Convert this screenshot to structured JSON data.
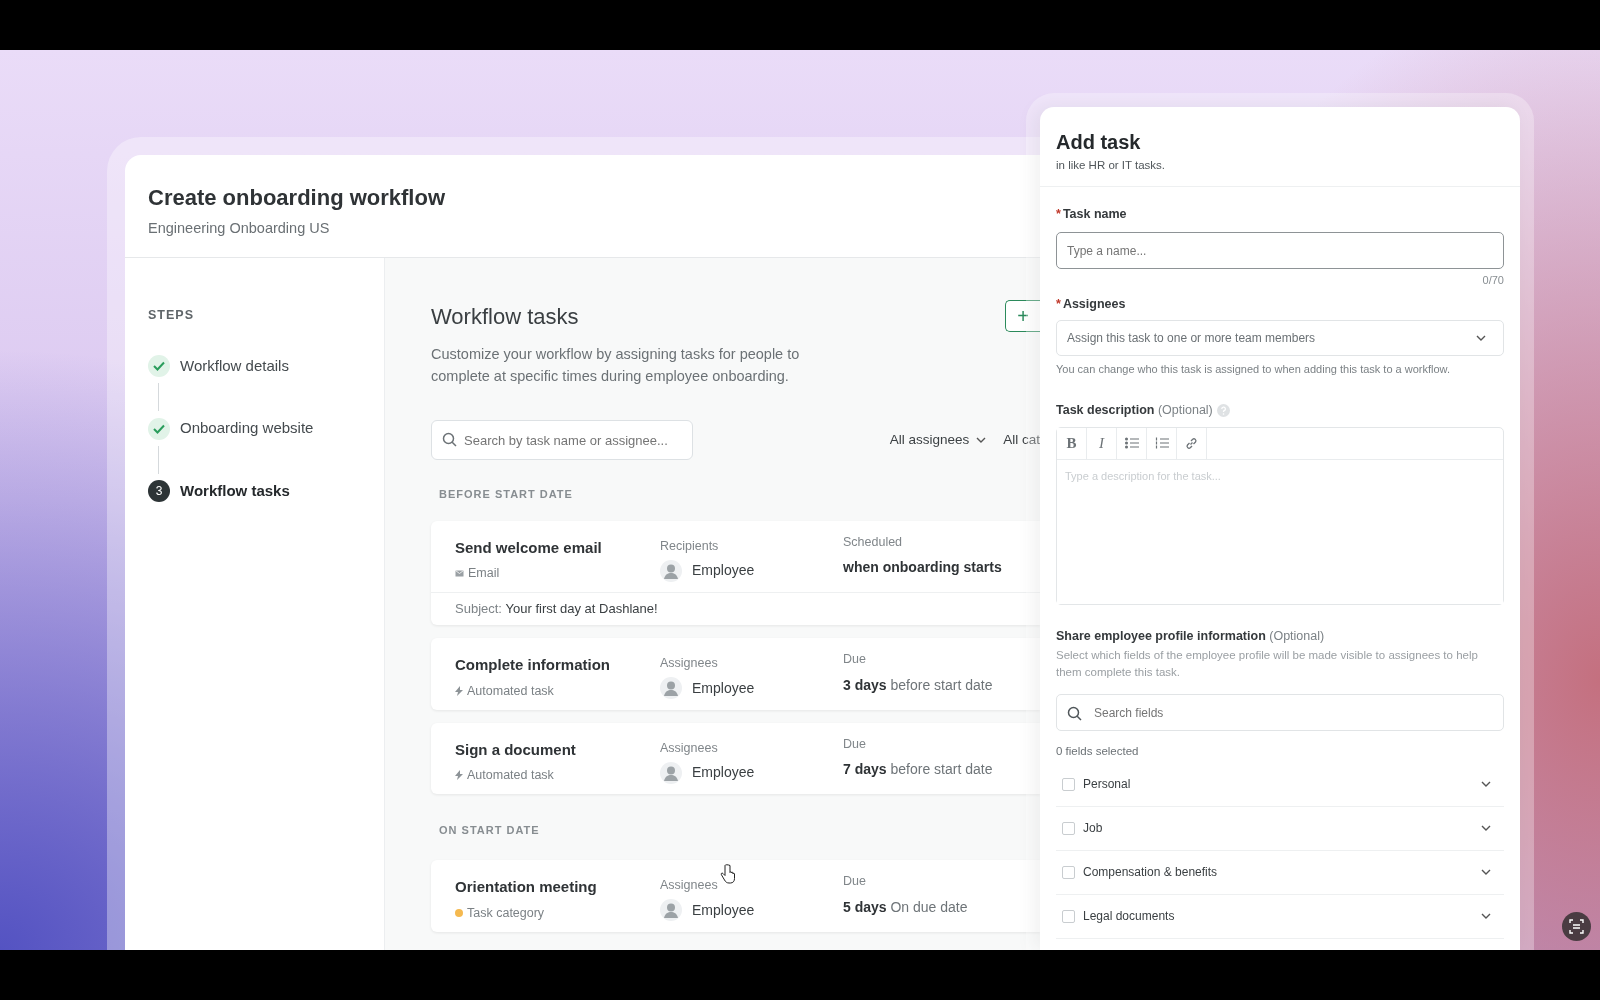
{
  "workflow": {
    "title": "Create onboarding workflow",
    "subtitle": "Engineering Onboarding US"
  },
  "steps_heading": "STEPS",
  "steps": [
    {
      "label": "Workflow details",
      "kind": "done",
      "selected": false
    },
    {
      "label": "Onboarding website",
      "kind": "done",
      "selected": false
    },
    {
      "label": "Workflow tasks",
      "kind": "current",
      "number": "3",
      "selected": true
    }
  ],
  "tasks_panel": {
    "title": "Workflow tasks",
    "description": "Customize your workflow by assigning tasks for people to complete at specific times during employee onboarding.",
    "add_button": "+",
    "search_placeholder": "Search by task name or assignee...",
    "filters": [
      {
        "label": "All assignees",
        "caret": true
      },
      {
        "label": "All cat",
        "caret": false
      }
    ]
  },
  "sections": [
    {
      "heading": "BEFORE START DATE",
      "tasks": [
        {
          "name": "Send welcome email",
          "type": {
            "kind": "email",
            "label": "Email"
          },
          "people_label": "Recipients",
          "person": "Employee",
          "timing_label": "Scheduled",
          "timing": "**when onboarding starts**",
          "subject": "Subject: **Your first day at Dashlane!**"
        },
        {
          "name": "Complete information",
          "type": {
            "kind": "automated",
            "label": "Automated task"
          },
          "people_label": "Assignees",
          "person": "Employee",
          "timing_label": "Due",
          "timing": "**3 days** before start date"
        },
        {
          "name": "Sign a document",
          "type": {
            "kind": "automated",
            "label": "Automated task"
          },
          "people_label": "Assignees",
          "person": "Employee",
          "timing_label": "Due",
          "timing": "**7 days** before start date"
        }
      ]
    },
    {
      "heading": "ON START DATE",
      "tasks": [
        {
          "name": "Orientation meeting",
          "type": {
            "kind": "category",
            "label": "Task category",
            "color": "#f5b94f"
          },
          "people_label": "Assignees",
          "person": "Employee",
          "timing_label": "Due",
          "timing": "**5 days** On due date"
        }
      ]
    }
  ],
  "add_task": {
    "title": "Add task",
    "subtitle": "in like HR or IT tasks.",
    "task_name": {
      "required_mark": "*",
      "label": "Task name",
      "placeholder": "Type a name...",
      "counter": "0/70"
    },
    "assignees": {
      "required_mark": "*",
      "label": "Assignees",
      "placeholder": "Assign this task to one or more team members",
      "hint": "You can change who this task is assigned to when adding this task to a workflow."
    },
    "description": {
      "label": "Task description",
      "optional": "(Optional)",
      "placeholder": "Type a description for the task...",
      "toolbar": [
        {
          "kind": "bold",
          "label": "B"
        },
        {
          "kind": "italic",
          "label": "I"
        },
        {
          "kind": "bullets"
        },
        {
          "kind": "numbers"
        },
        {
          "kind": "link"
        }
      ]
    },
    "share": {
      "label": "Share employee profile information",
      "optional": "(Optional)",
      "description": "Select which fields of the employee profile will be made visible to assignees to help them complete this task.",
      "search_placeholder": "Search fields",
      "count": "0 fields selected",
      "groups": [
        {
          "label": "Personal",
          "checked": false,
          "expanded": false
        },
        {
          "label": "Job",
          "checked": false,
          "expanded": false
        },
        {
          "label": "Compensation & benefits",
          "checked": false,
          "expanded": false
        },
        {
          "label": "Legal documents",
          "checked": false,
          "expanded": false
        }
      ]
    }
  }
}
